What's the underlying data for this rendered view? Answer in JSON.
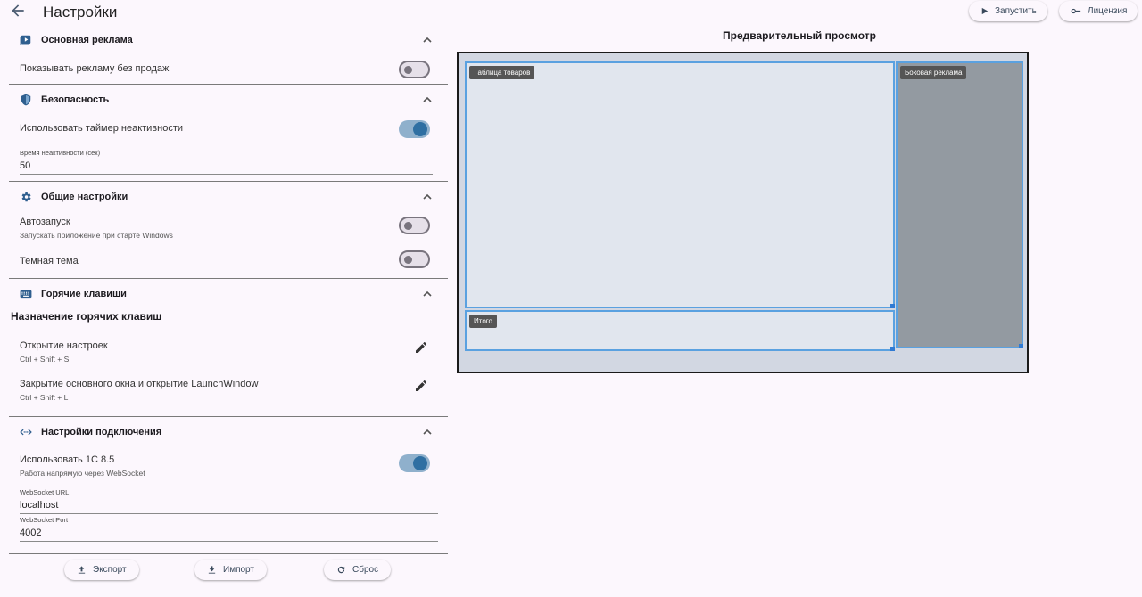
{
  "header": {
    "title": "Настройки",
    "run_label": "Запустить",
    "license_label": "Лицензия"
  },
  "sections": {
    "ads": {
      "title": "Основная реклама",
      "show_without_sales": "Показывать рекламу без продаж",
      "show_without_sales_on": false
    },
    "security": {
      "title": "Безопасность",
      "inactivity_timer": "Использовать таймер неактивности",
      "inactivity_timer_on": true,
      "inactivity_time_label": "Время неактивности (сек)",
      "inactivity_time_value": "50"
    },
    "general": {
      "title": "Общие настройки",
      "autostart": "Автозапуск",
      "autostart_sub": "Запускать приложение при старте Windows",
      "autostart_on": false,
      "dark_theme": "Темная тема",
      "dark_theme_on": false
    },
    "hotkeys": {
      "title": "Горячие клавиши",
      "heading": "Назначение горячих клавиш",
      "items": [
        {
          "label": "Открытие настроек",
          "keys": "Ctrl + Shift + S"
        },
        {
          "label": "Закрытие основного окна и открытие LaunchWindow",
          "keys": "Ctrl + Shift + L"
        }
      ]
    },
    "connection": {
      "title": "Настройки подключения",
      "use_1c": "Использовать 1С 8.5",
      "use_1c_sub": "Работа напрямую через WebSocket",
      "use_1c_on": true,
      "ws_url_label": "WebSocket URL",
      "ws_url_value": "localhost",
      "ws_port_label": "WebSocket Port",
      "ws_port_value": "4002"
    }
  },
  "footer": {
    "export_label": "Экспорт",
    "import_label": "Импорт",
    "reset_label": "Сброс"
  },
  "preview": {
    "title": "Предварительный просмотр",
    "zones": {
      "main": "Таблица товаров",
      "total": "Итого",
      "side": "Боковая реклама"
    }
  },
  "colors": {
    "background": "#fcf7fd",
    "toggle_on": "#2f6fa2",
    "zone_border": "#5aa1e0",
    "side_zone": "#939aa1"
  },
  "icons": {
    "back": "arrow-left-icon",
    "run": "play-icon",
    "license": "key-icon",
    "ads": "video-library-icon",
    "security": "shield-icon",
    "general": "gear-icon",
    "hotkeys": "keyboard-icon",
    "connection": "code-arrows-icon",
    "edit": "pencil-icon",
    "export": "upload-icon",
    "import": "download-icon",
    "reset": "refresh-icon"
  }
}
